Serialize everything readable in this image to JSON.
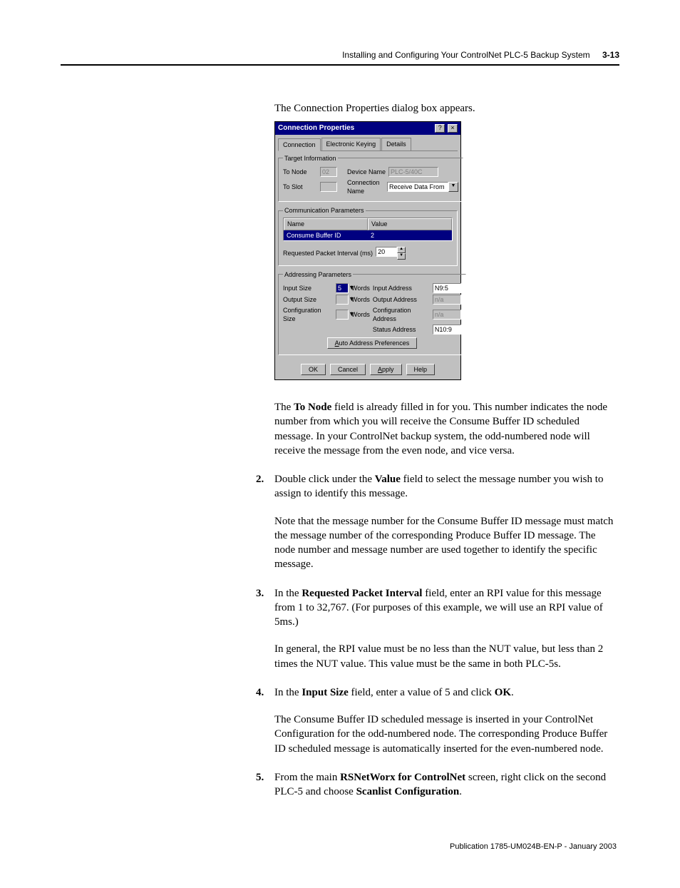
{
  "header": {
    "running": "Installing and Configuring Your ControlNet PLC-5 Backup System",
    "pagenum": "3-13"
  },
  "intro": "The Connection Properties dialog box appears.",
  "dialog": {
    "title": "Connection Properties",
    "help_btn": "?",
    "close_btn": "×",
    "tabs": {
      "t1": "Connection",
      "t2": "Electronic Keying",
      "t3": "Details"
    },
    "target_legend": "Target Information",
    "to_node_lbl": "To Node",
    "to_node_val": "02",
    "device_name_lbl": "Device Name",
    "device_name_val": "PLC-5/40C",
    "to_slot_lbl": "To Slot",
    "to_slot_val": "",
    "conn_name_lbl": "Connection Name",
    "conn_name_val": "Receive Data From",
    "comm_legend": "Communication Parameters",
    "table_name_hdr": "Name",
    "table_value_hdr": "Value",
    "table_row_name": "Consume Buffer ID",
    "table_row_val": "2",
    "rpi_lbl": "Requested Packet Interval (ms)",
    "rpi_val": "20",
    "addr_legend": "Addressing Parameters",
    "input_size_lbl": "Input Size",
    "input_size_val": "5",
    "input_addr_lbl": "Input Address",
    "input_addr_val": "N9:5",
    "output_size_lbl": "Output Size",
    "output_size_val": "",
    "output_addr_lbl": "Output Address",
    "output_addr_val": "n/a",
    "config_size_lbl": "Configuration Size",
    "config_size_val": "",
    "config_addr_lbl": "Configuration Address",
    "config_addr_val": "n/a",
    "status_addr_lbl": "Status Address",
    "status_addr_val": "N10:9",
    "words_lbl": "Words",
    "auto_btn": "Auto Address Preferences",
    "ok_btn": "OK",
    "cancel_btn": "Cancel",
    "apply_btn": "Apply",
    "help_btn2": "Help"
  },
  "para1_a": "The ",
  "para1_b": "To Node",
  "para1_c": " field is already filled in for you. This number indicates the node number from which you will receive the Consume Buffer ID scheduled message. In your ControlNet backup system, the odd-numbered node will receive the message from the even node, and vice versa.",
  "step2_a": "Double click under the ",
  "step2_b": "Value",
  "step2_c": " field to select the message number you wish to assign to identify this message.",
  "step2_sub": "Note that the message number for the Consume Buffer ID message must match the message number of the corresponding Produce Buffer ID message. The node number and message number are used together to identify the specific message.",
  "step3_a": "In the ",
  "step3_b": "Requested Packet Interval",
  "step3_c": " field, enter an RPI value for this message from 1 to 32,767. (For purposes of this example, we will use an RPI value of 5ms.)",
  "step3_sub": "In general, the RPI value must be no less than the NUT value, but less than 2 times the NUT value. This value must be the same in both PLC-5s.",
  "step4_a": "In the ",
  "step4_b": "Input Size",
  "step4_c": " field, enter a value of 5 and click ",
  "step4_d": "OK",
  "step4_e": ".",
  "step4_sub": "The Consume Buffer ID scheduled message is inserted in your ControlNet Configuration for the odd-numbered node. The corresponding Produce Buffer ID scheduled message is automatically inserted for the even-numbered node.",
  "step5_a": "From the main ",
  "step5_b": "RSNetWorx for ControlNet",
  "step5_c": " screen, right click on the second PLC-5 and choose ",
  "step5_d": "Scanlist Configuration",
  "step5_e": ".",
  "footer": "Publication 1785-UM024B-EN-P - January 2003"
}
